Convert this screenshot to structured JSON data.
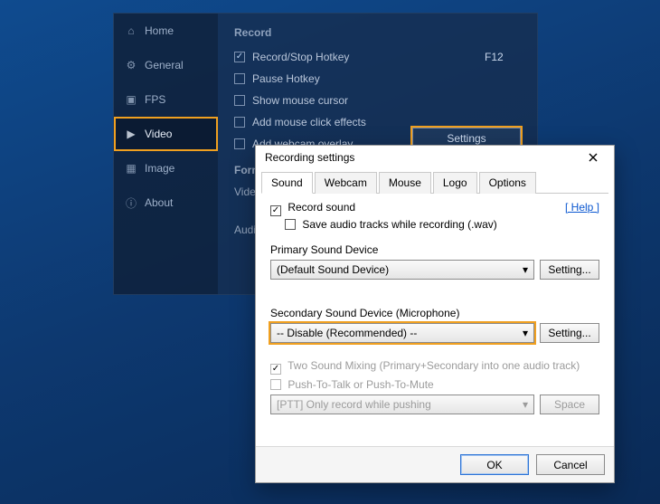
{
  "sidebar": {
    "items": [
      {
        "label": "Home",
        "icon": "home"
      },
      {
        "label": "General",
        "icon": "gear"
      },
      {
        "label": "FPS",
        "icon": "fps"
      },
      {
        "label": "Video",
        "icon": "video"
      },
      {
        "label": "Image",
        "icon": "image"
      },
      {
        "label": "About",
        "icon": "info"
      }
    ]
  },
  "record": {
    "heading": "Record",
    "items": [
      {
        "label": "Record/Stop Hotkey",
        "checked": true,
        "value": "F12"
      },
      {
        "label": "Pause Hotkey",
        "checked": false,
        "value": ""
      },
      {
        "label": "Show mouse cursor",
        "checked": false
      },
      {
        "label": "Add mouse click effects",
        "checked": false
      },
      {
        "label": "Add webcam overlay",
        "checked": false
      }
    ],
    "settings_button": "Settings"
  },
  "format_section": {
    "heading": "Form",
    "video_prefix": "Vide",
    "audio_prefix": "Audi"
  },
  "dialog": {
    "title": "Recording settings",
    "tabs": [
      "Sound",
      "Webcam",
      "Mouse",
      "Logo",
      "Options"
    ],
    "record_sound": "Record sound",
    "save_tracks": "Save audio tracks while recording (.wav)",
    "help": "[ Help ]",
    "primary": {
      "label": "Primary Sound Device",
      "value": "(Default Sound Device)",
      "button": "Setting..."
    },
    "secondary": {
      "label": "Secondary Sound Device (Microphone)",
      "value": "-- Disable (Recommended) --",
      "button": "Setting..."
    },
    "mix": "Two Sound Mixing (Primary+Secondary into one audio track)",
    "ptt": "Push-To-Talk or Push-To-Mute",
    "ptt_mode": "[PTT] Only record while pushing",
    "ptt_key": "Space",
    "ok": "OK",
    "cancel": "Cancel"
  },
  "highlights": {
    "color": "#f0a020"
  }
}
